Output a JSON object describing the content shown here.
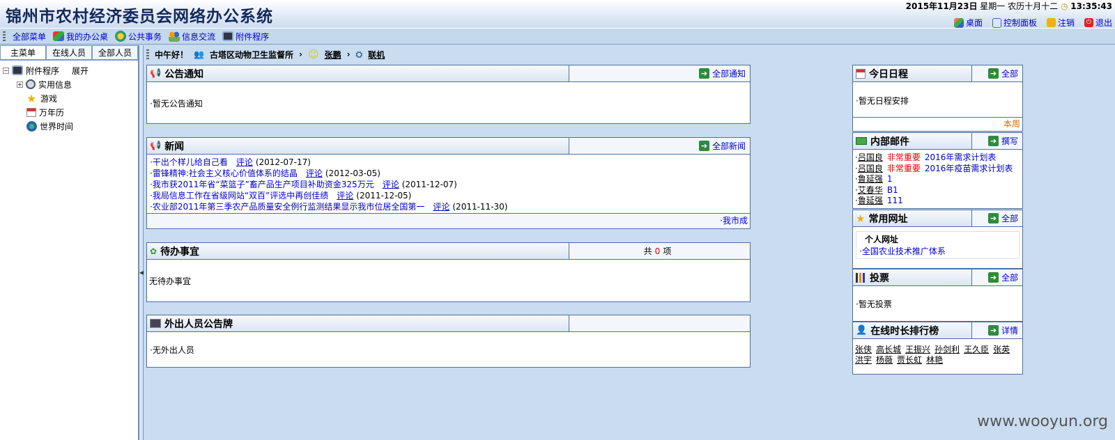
{
  "header": {
    "title": "锦州市农村经济委员会网络办公系统",
    "date": "2015年11月23日",
    "weekday": "星期一",
    "lunar": "农历十月十二",
    "time": "13:35:43",
    "actions": [
      {
        "label": "桌面",
        "icon": "desktop-icon"
      },
      {
        "label": "控制面板",
        "icon": "control-panel-icon"
      },
      {
        "label": "注销",
        "icon": "logout-icon"
      },
      {
        "label": "退出",
        "icon": "exit-icon"
      }
    ]
  },
  "menubar": {
    "items": [
      {
        "label": "全部菜单",
        "icon": "menu-grid-icon"
      },
      {
        "label": "我的办公桌",
        "icon": "desk-icon"
      },
      {
        "label": "公共事务",
        "icon": "public-affairs-icon"
      },
      {
        "label": "信息交流",
        "icon": "people-icon"
      },
      {
        "label": "附件程序",
        "icon": "attachment-program-icon"
      }
    ]
  },
  "left": {
    "tabs": [
      "主菜单",
      "在线人员",
      "全部人员"
    ],
    "tree_root": "附件程序",
    "tree_root_action": "展开",
    "tree_items": [
      {
        "label": "实用信息",
        "icon": "magnifier-icon"
      },
      {
        "label": "游戏",
        "icon": "star-icon"
      },
      {
        "label": "万年历",
        "icon": "calendar-icon"
      },
      {
        "label": "世界时间",
        "icon": "globe-icon"
      }
    ]
  },
  "greeting": {
    "hello": "中午好！",
    "org": "古塔区动物卫生监督所",
    "user": "张鹏",
    "status": "联机"
  },
  "panels": {
    "notice": {
      "title": "公告通知",
      "more": "全部通知",
      "empty": "·暂无公告通知"
    },
    "news": {
      "title": "新闻",
      "more": "全部新闻",
      "comment_label": "评论",
      "items": [
        {
          "title": "·干出个样儿给自己看",
          "date": "(2012-07-17)"
        },
        {
          "title": "·雷锋精神:社会主义核心价值体系的结晶",
          "date": "(2012-03-05)"
        },
        {
          "title": "·我市获2011年省“菜篮子”畜产品生产项目补助资金325万元",
          "date": "(2011-12-07)"
        },
        {
          "title": "·我局信息工作在省级网站“双百”评选中再创佳绩",
          "date": "(2011-12-05)"
        },
        {
          "title": "·农业部2011年第三季农产品质量安全例行监测结果显示我市位居全国第一",
          "date": "(2011-11-30)"
        }
      ],
      "footer": "·我市成"
    },
    "todo": {
      "title": "待办事宜",
      "count_prefix": "共",
      "count": "0",
      "count_suffix": "项",
      "empty": "无待办事宜"
    },
    "outing": {
      "title": "外出人员公告牌",
      "empty": "·无外出人员"
    },
    "schedule": {
      "title": "今日日程",
      "more": "全部",
      "empty": "·暂无日程安排",
      "week": "本周"
    },
    "mail": {
      "title": "内部邮件",
      "more": "撰写",
      "items": [
        {
          "sender": "吕国良",
          "importance": "非常重要",
          "subject": "2016年需求计划表"
        },
        {
          "sender": "吕国良",
          "importance": "非常重要",
          "subject": "2016年疫苗需求计划表"
        },
        {
          "sender": "鲁延强",
          "importance": "",
          "subject": "1"
        },
        {
          "sender": "艾春华",
          "importance": "",
          "subject": "B1"
        },
        {
          "sender": "鲁延强",
          "importance": "",
          "subject": "111"
        }
      ]
    },
    "links": {
      "title": "常用网址",
      "more": "全部",
      "section": "个人网址",
      "items": [
        "·全国农业技术推广体系"
      ]
    },
    "vote": {
      "title": "投票",
      "more": "全部",
      "empty": "·暂无投票"
    },
    "online": {
      "title": "在线时长排行榜",
      "more": "详情",
      "users": [
        "张侠",
        "高长城",
        "王振兴",
        "孙剑利",
        "王久臣",
        "张英",
        "洪宇",
        "杨薇",
        "贾长虹",
        "林艳"
      ]
    }
  },
  "watermark": "www.wooyun.org",
  "colors": {
    "accent_link": "#0000cc",
    "important": "#e00000",
    "background": "#c9dcf0"
  }
}
